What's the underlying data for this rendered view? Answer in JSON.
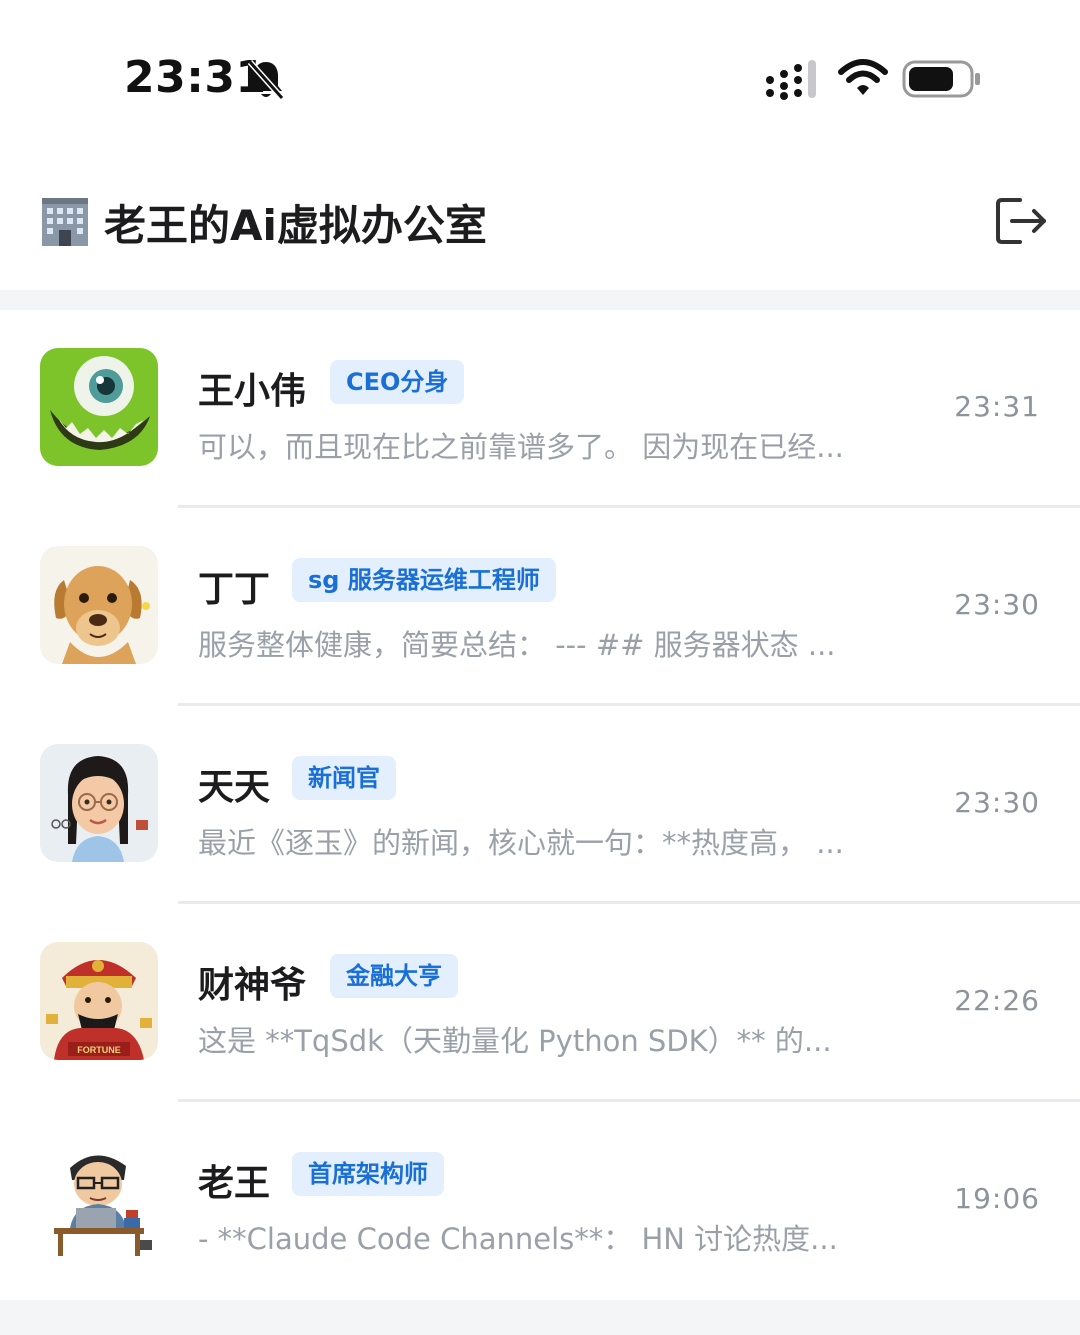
{
  "status_bar": {
    "time": "23:31",
    "icons": [
      "bell-slash-icon",
      "signal-icon",
      "wifi-icon",
      "battery-icon"
    ]
  },
  "header": {
    "icon": "office-building-icon",
    "title": "老王的Ai虚拟办公室",
    "action_icon": "logout-icon"
  },
  "colors": {
    "badge_bg": "#e3effd",
    "badge_text": "#1a6fd6",
    "preview_text": "#9aa0a8",
    "page_bg": "#f4f5f7"
  },
  "chats": [
    {
      "name": "王小伟",
      "badge": "CEO分身",
      "preview": "可以，而且现在比之前靠谱多了。 因为现在已经...",
      "time": "23:31",
      "avatar_icon": "green-one-eyed-monster-avatar"
    },
    {
      "name": "丁丁",
      "badge": "sg 服务器运维工程师",
      "preview": "服务整体健康，简要总结： --- ## 服务器状态 ...",
      "time": "23:30",
      "avatar_icon": "golden-retriever-dog-avatar"
    },
    {
      "name": "天天",
      "badge": "新闻官",
      "preview": "最近《逐玉》的新闻，核心就一句：**热度高， ...",
      "time": "23:30",
      "avatar_icon": "girl-with-glasses-avatar"
    },
    {
      "name": "财神爷",
      "badge": "金融大亨",
      "preview": "这是 **TqSdk（天勤量化 Python SDK）** 的...",
      "time": "22:26",
      "avatar_icon": "god-of-wealth-avatar",
      "avatar_text": "FORTUNE"
    },
    {
      "name": "老王",
      "badge": "首席架构师",
      "preview": "- **Claude Code Channels**： HN 讨论热度...",
      "time": "19:06",
      "avatar_icon": "programmer-at-desk-avatar"
    }
  ]
}
